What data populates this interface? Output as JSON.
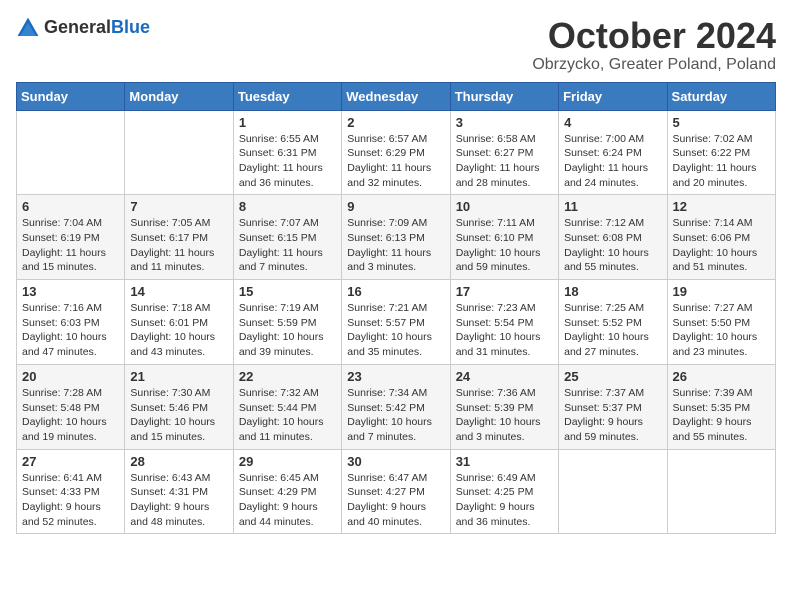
{
  "logo": {
    "general": "General",
    "blue": "Blue"
  },
  "title": "October 2024",
  "location": "Obrzycko, Greater Poland, Poland",
  "days_of_week": [
    "Sunday",
    "Monday",
    "Tuesday",
    "Wednesday",
    "Thursday",
    "Friday",
    "Saturday"
  ],
  "weeks": [
    [
      {
        "day": "",
        "info": ""
      },
      {
        "day": "",
        "info": ""
      },
      {
        "day": "1",
        "info": "Sunrise: 6:55 AM\nSunset: 6:31 PM\nDaylight: 11 hours and 36 minutes."
      },
      {
        "day": "2",
        "info": "Sunrise: 6:57 AM\nSunset: 6:29 PM\nDaylight: 11 hours and 32 minutes."
      },
      {
        "day": "3",
        "info": "Sunrise: 6:58 AM\nSunset: 6:27 PM\nDaylight: 11 hours and 28 minutes."
      },
      {
        "day": "4",
        "info": "Sunrise: 7:00 AM\nSunset: 6:24 PM\nDaylight: 11 hours and 24 minutes."
      },
      {
        "day": "5",
        "info": "Sunrise: 7:02 AM\nSunset: 6:22 PM\nDaylight: 11 hours and 20 minutes."
      }
    ],
    [
      {
        "day": "6",
        "info": "Sunrise: 7:04 AM\nSunset: 6:19 PM\nDaylight: 11 hours and 15 minutes."
      },
      {
        "day": "7",
        "info": "Sunrise: 7:05 AM\nSunset: 6:17 PM\nDaylight: 11 hours and 11 minutes."
      },
      {
        "day": "8",
        "info": "Sunrise: 7:07 AM\nSunset: 6:15 PM\nDaylight: 11 hours and 7 minutes."
      },
      {
        "day": "9",
        "info": "Sunrise: 7:09 AM\nSunset: 6:13 PM\nDaylight: 11 hours and 3 minutes."
      },
      {
        "day": "10",
        "info": "Sunrise: 7:11 AM\nSunset: 6:10 PM\nDaylight: 10 hours and 59 minutes."
      },
      {
        "day": "11",
        "info": "Sunrise: 7:12 AM\nSunset: 6:08 PM\nDaylight: 10 hours and 55 minutes."
      },
      {
        "day": "12",
        "info": "Sunrise: 7:14 AM\nSunset: 6:06 PM\nDaylight: 10 hours and 51 minutes."
      }
    ],
    [
      {
        "day": "13",
        "info": "Sunrise: 7:16 AM\nSunset: 6:03 PM\nDaylight: 10 hours and 47 minutes."
      },
      {
        "day": "14",
        "info": "Sunrise: 7:18 AM\nSunset: 6:01 PM\nDaylight: 10 hours and 43 minutes."
      },
      {
        "day": "15",
        "info": "Sunrise: 7:19 AM\nSunset: 5:59 PM\nDaylight: 10 hours and 39 minutes."
      },
      {
        "day": "16",
        "info": "Sunrise: 7:21 AM\nSunset: 5:57 PM\nDaylight: 10 hours and 35 minutes."
      },
      {
        "day": "17",
        "info": "Sunrise: 7:23 AM\nSunset: 5:54 PM\nDaylight: 10 hours and 31 minutes."
      },
      {
        "day": "18",
        "info": "Sunrise: 7:25 AM\nSunset: 5:52 PM\nDaylight: 10 hours and 27 minutes."
      },
      {
        "day": "19",
        "info": "Sunrise: 7:27 AM\nSunset: 5:50 PM\nDaylight: 10 hours and 23 minutes."
      }
    ],
    [
      {
        "day": "20",
        "info": "Sunrise: 7:28 AM\nSunset: 5:48 PM\nDaylight: 10 hours and 19 minutes."
      },
      {
        "day": "21",
        "info": "Sunrise: 7:30 AM\nSunset: 5:46 PM\nDaylight: 10 hours and 15 minutes."
      },
      {
        "day": "22",
        "info": "Sunrise: 7:32 AM\nSunset: 5:44 PM\nDaylight: 10 hours and 11 minutes."
      },
      {
        "day": "23",
        "info": "Sunrise: 7:34 AM\nSunset: 5:42 PM\nDaylight: 10 hours and 7 minutes."
      },
      {
        "day": "24",
        "info": "Sunrise: 7:36 AM\nSunset: 5:39 PM\nDaylight: 10 hours and 3 minutes."
      },
      {
        "day": "25",
        "info": "Sunrise: 7:37 AM\nSunset: 5:37 PM\nDaylight: 9 hours and 59 minutes."
      },
      {
        "day": "26",
        "info": "Sunrise: 7:39 AM\nSunset: 5:35 PM\nDaylight: 9 hours and 55 minutes."
      }
    ],
    [
      {
        "day": "27",
        "info": "Sunrise: 6:41 AM\nSunset: 4:33 PM\nDaylight: 9 hours and 52 minutes."
      },
      {
        "day": "28",
        "info": "Sunrise: 6:43 AM\nSunset: 4:31 PM\nDaylight: 9 hours and 48 minutes."
      },
      {
        "day": "29",
        "info": "Sunrise: 6:45 AM\nSunset: 4:29 PM\nDaylight: 9 hours and 44 minutes."
      },
      {
        "day": "30",
        "info": "Sunrise: 6:47 AM\nSunset: 4:27 PM\nDaylight: 9 hours and 40 minutes."
      },
      {
        "day": "31",
        "info": "Sunrise: 6:49 AM\nSunset: 4:25 PM\nDaylight: 9 hours and 36 minutes."
      },
      {
        "day": "",
        "info": ""
      },
      {
        "day": "",
        "info": ""
      }
    ]
  ]
}
